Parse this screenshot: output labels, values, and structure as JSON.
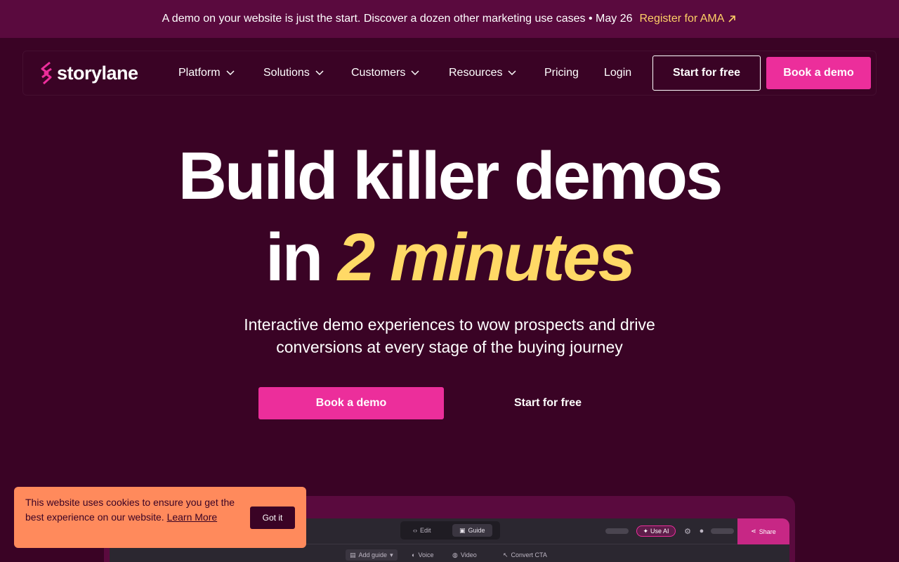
{
  "announcement": {
    "text": "A demo on your website is just the start. Discover a dozen other marketing use cases • May 26",
    "link_label": "Register for AMA"
  },
  "nav": {
    "logo_text": "storylane",
    "items": [
      {
        "label": "Platform",
        "dropdown": true
      },
      {
        "label": "Solutions",
        "dropdown": true
      },
      {
        "label": "Customers",
        "dropdown": true
      },
      {
        "label": "Resources",
        "dropdown": true
      },
      {
        "label": "Pricing",
        "dropdown": false
      },
      {
        "label": "Login",
        "dropdown": false
      }
    ],
    "start_free_label": "Start for free",
    "book_demo_label": "Book a demo"
  },
  "hero": {
    "line1": "Build killer demos",
    "line2_prefix": "in ",
    "line2_accent": "2 minutes",
    "subtitle": "Interactive demo experiences to wow prospects and drive conversions at every stage of the buying journey",
    "cta_primary": "Book a demo",
    "cta_secondary": "Start for free"
  },
  "preview": {
    "tabs": [
      {
        "label": "Edit",
        "icon": "code-icon"
      },
      {
        "label": "Guide",
        "icon": "guide-icon"
      }
    ],
    "use_ai_label": "Use AI",
    "share_label": "Share",
    "toolbar": [
      {
        "label": "Add guide",
        "icon": "add-guide-icon"
      },
      {
        "label": "Voice",
        "icon": "voice-icon"
      },
      {
        "label": "Video",
        "icon": "video-icon"
      },
      {
        "label": "Convert CTA",
        "icon": "cursor-icon"
      }
    ]
  },
  "cookie": {
    "text": "This website uses cookies to ensure you get the best experience on our website.",
    "learn_more": "Learn More",
    "button": "Got it"
  },
  "colors": {
    "background": "#3a0325",
    "announcement_bg": "#5a0a3e",
    "accent_pink": "#ec2e9b",
    "accent_yellow": "#ffd966",
    "cookie_bg": "#ff8a5c"
  }
}
